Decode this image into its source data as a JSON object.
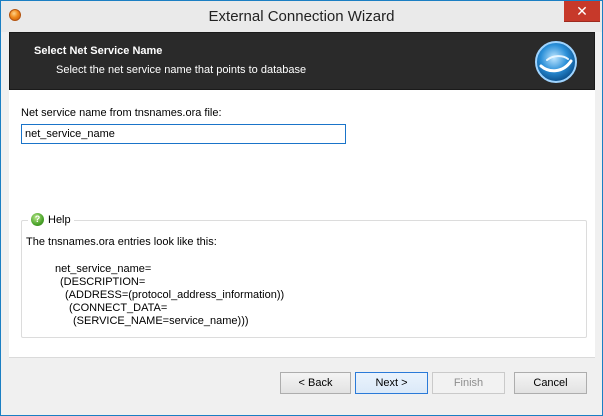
{
  "window": {
    "title": "External Connection Wizard",
    "close_glyph": "✕"
  },
  "header": {
    "title": "Select Net Service Name",
    "subtitle": "Select the net service name that points to database",
    "logo_icon": "globe-swirl-icon"
  },
  "form": {
    "field_label": "Net service name from tnsnames.ora file:",
    "field_value": "net_service_name"
  },
  "help": {
    "title": "Help",
    "icon_glyph": "?",
    "intro": "The tnsnames.ora entries look like this:",
    "code_lines": [
      "net_service_name=",
      "(DESCRIPTION=",
      "(ADDRESS=(protocol_address_information))",
      "(CONNECT_DATA=",
      "(SERVICE_NAME=service_name)))"
    ]
  },
  "buttons": {
    "back": "< Back",
    "next": "Next >",
    "finish": "Finish",
    "cancel": "Cancel"
  },
  "colors": {
    "header_bg": "#2a2a2a",
    "close_bg": "#c7392a",
    "input_border": "#1a74c9"
  }
}
